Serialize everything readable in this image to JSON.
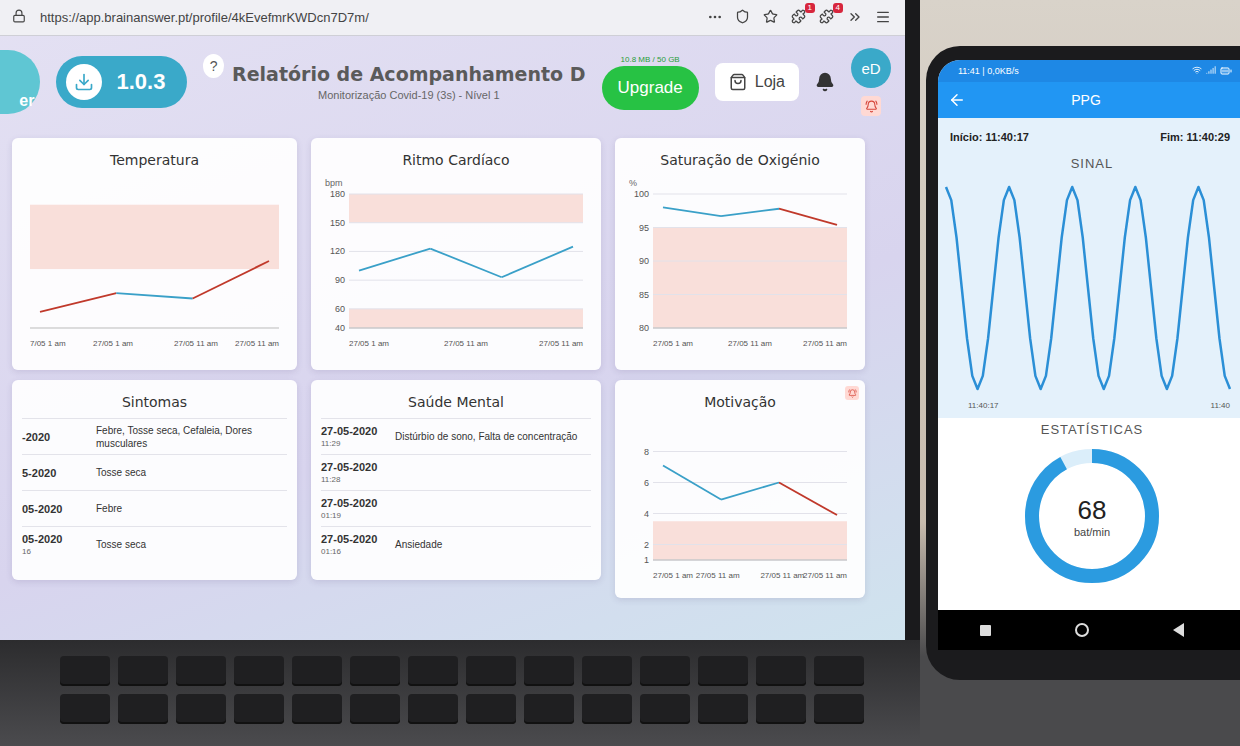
{
  "browser": {
    "url": "https://app.brainanswer.pt/profile/4kEvefmrKWDcn7D7m/",
    "badges": [
      "1",
      "4"
    ]
  },
  "header": {
    "logo": "er",
    "version": "1.0.3",
    "help": "?",
    "title": "Relatório de Acompanhamento D",
    "subtitle": "Monitorização Covid-19 (3s) - Nível 1",
    "storage": "10.8 MB / 50 GB",
    "upgrade": "Upgrade",
    "shop": "Loja",
    "avatar": "eD",
    "notification": true
  },
  "cards": [
    {
      "kind": "chart",
      "title": "Temperatura",
      "unit": "",
      "y_range": [
        35,
        40
      ],
      "ticks": [],
      "bands": [
        [
          37.2,
          39.6
        ]
      ],
      "values": [
        35.6,
        36.3,
        36.1,
        37.5
      ],
      "segment_colors": [
        "#c0392b",
        "#3aa0c8",
        "#c0392b"
      ],
      "x_labels": [
        "7/05 1 am",
        "27/05 1 am",
        "27/05 11 am",
        "27/05 11 am"
      ],
      "alert": false
    },
    {
      "kind": "chart",
      "title": "Ritmo Cardíaco",
      "unit": "bpm",
      "y_range": [
        40,
        180
      ],
      "ticks": [
        {
          "label": "180",
          "value": 180
        },
        {
          "label": "150",
          "value": 150
        },
        {
          "label": "120",
          "value": 120
        },
        {
          "label": "90",
          "value": 90
        },
        {
          "label": "60",
          "value": 60
        },
        {
          "label": "40",
          "value": 40
        }
      ],
      "bands": [
        [
          150,
          180
        ],
        [
          40,
          60
        ]
      ],
      "values": [
        100,
        123,
        93,
        125
      ],
      "segment_colors": [
        "#3aa0c8",
        "#3aa0c8",
        "#3aa0c8"
      ],
      "x_labels": [
        "27/05 1 am",
        "27/05 11 am",
        "27/05 11 am"
      ],
      "alert": false
    },
    {
      "kind": "chart",
      "title": "Saturação de Oxigénio",
      "unit": "%",
      "y_range": [
        80,
        100
      ],
      "ticks": [
        {
          "label": "100",
          "value": 100
        },
        {
          "label": "95",
          "value": 95
        },
        {
          "label": "90",
          "value": 90
        },
        {
          "label": "85",
          "value": 85
        },
        {
          "label": "80",
          "value": 80
        }
      ],
      "bands": [
        [
          80,
          95
        ]
      ],
      "values": [
        98,
        96.7,
        97.8,
        95.4
      ],
      "segment_colors": [
        "#3aa0c8",
        "#3aa0c8",
        "#c0392b"
      ],
      "x_labels": [
        "27/05 1 am",
        "27/05 11 am",
        "27/05 11 am"
      ],
      "alert": false
    },
    {
      "kind": "table",
      "title": "Sintomas",
      "rows": [
        {
          "date": "-2020",
          "time": "",
          "text": "Febre, Tosse seca, Cefaleia, Dores musculares"
        },
        {
          "date": "5-2020",
          "time": "",
          "text": "Tosse seca"
        },
        {
          "date": "05-2020",
          "time": "",
          "text": "Febre"
        },
        {
          "date": "05-2020",
          "time": "16",
          "text": "Tosse seca"
        }
      ]
    },
    {
      "kind": "table",
      "title": "Saúde Mental",
      "rows": [
        {
          "date": "27-05-2020",
          "time": "11:29",
          "text": "Distúrbio de sono, Falta de concentração"
        },
        {
          "date": "27-05-2020",
          "time": "11:28",
          "text": ""
        },
        {
          "date": "27-05-2020",
          "time": "01:19",
          "text": ""
        },
        {
          "date": "27-05-2020",
          "time": "01:16",
          "text": "Ansiedade"
        }
      ]
    },
    {
      "kind": "chart",
      "title": "Motivação",
      "unit": "",
      "y_range": [
        1,
        9
      ],
      "ticks": [
        {
          "label": "8",
          "value": 8
        },
        {
          "label": "6",
          "value": 6
        },
        {
          "label": "4",
          "value": 4
        },
        {
          "label": "2",
          "value": 2
        },
        {
          "label": "1",
          "value": 1
        }
      ],
      "bands": [
        [
          1,
          3.5
        ]
      ],
      "values": [
        7.1,
        4.9,
        6,
        3.9
      ],
      "segment_colors": [
        "#3aa0c8",
        "#3aa0c8",
        "#c0392b"
      ],
      "x_labels": [
        "27/05 1 am",
        "27/05 11 am",
        "27/05 11 am",
        "27/05 11 am"
      ],
      "alert": true
    }
  ],
  "phone": {
    "status": "11:41 | 0,0KB/s",
    "title": "PPG",
    "start": "Início: 11:40:17",
    "end": "Fim: 11:40:29",
    "signal_title": "SINAL",
    "signal": [
      1,
      0.87,
      0.5,
      0,
      -0.5,
      -0.87,
      -1,
      -0.87,
      -0.5,
      0,
      0.5,
      0.87,
      1,
      0.87,
      0.5,
      0,
      -0.5,
      -0.87,
      -1,
      -0.87,
      -0.5,
      0,
      0.5,
      0.87,
      1,
      0.87,
      0.5,
      0,
      -0.5,
      -0.87,
      -1,
      -0.87,
      -0.5,
      0,
      0.5,
      0.87,
      1,
      0.87,
      0.5,
      0,
      -0.5,
      -0.87,
      -1,
      -0.87,
      -0.5,
      0,
      0.5,
      0.87,
      1,
      0.87,
      0.5,
      0,
      -0.5,
      -0.87,
      -1
    ],
    "time_start": "11:40:17",
    "time_end": "11:40",
    "stats_title": "ESTATÍSTICAS",
    "bpm": "68",
    "bpm_unit": "bat/min",
    "level": 0.92
  }
}
